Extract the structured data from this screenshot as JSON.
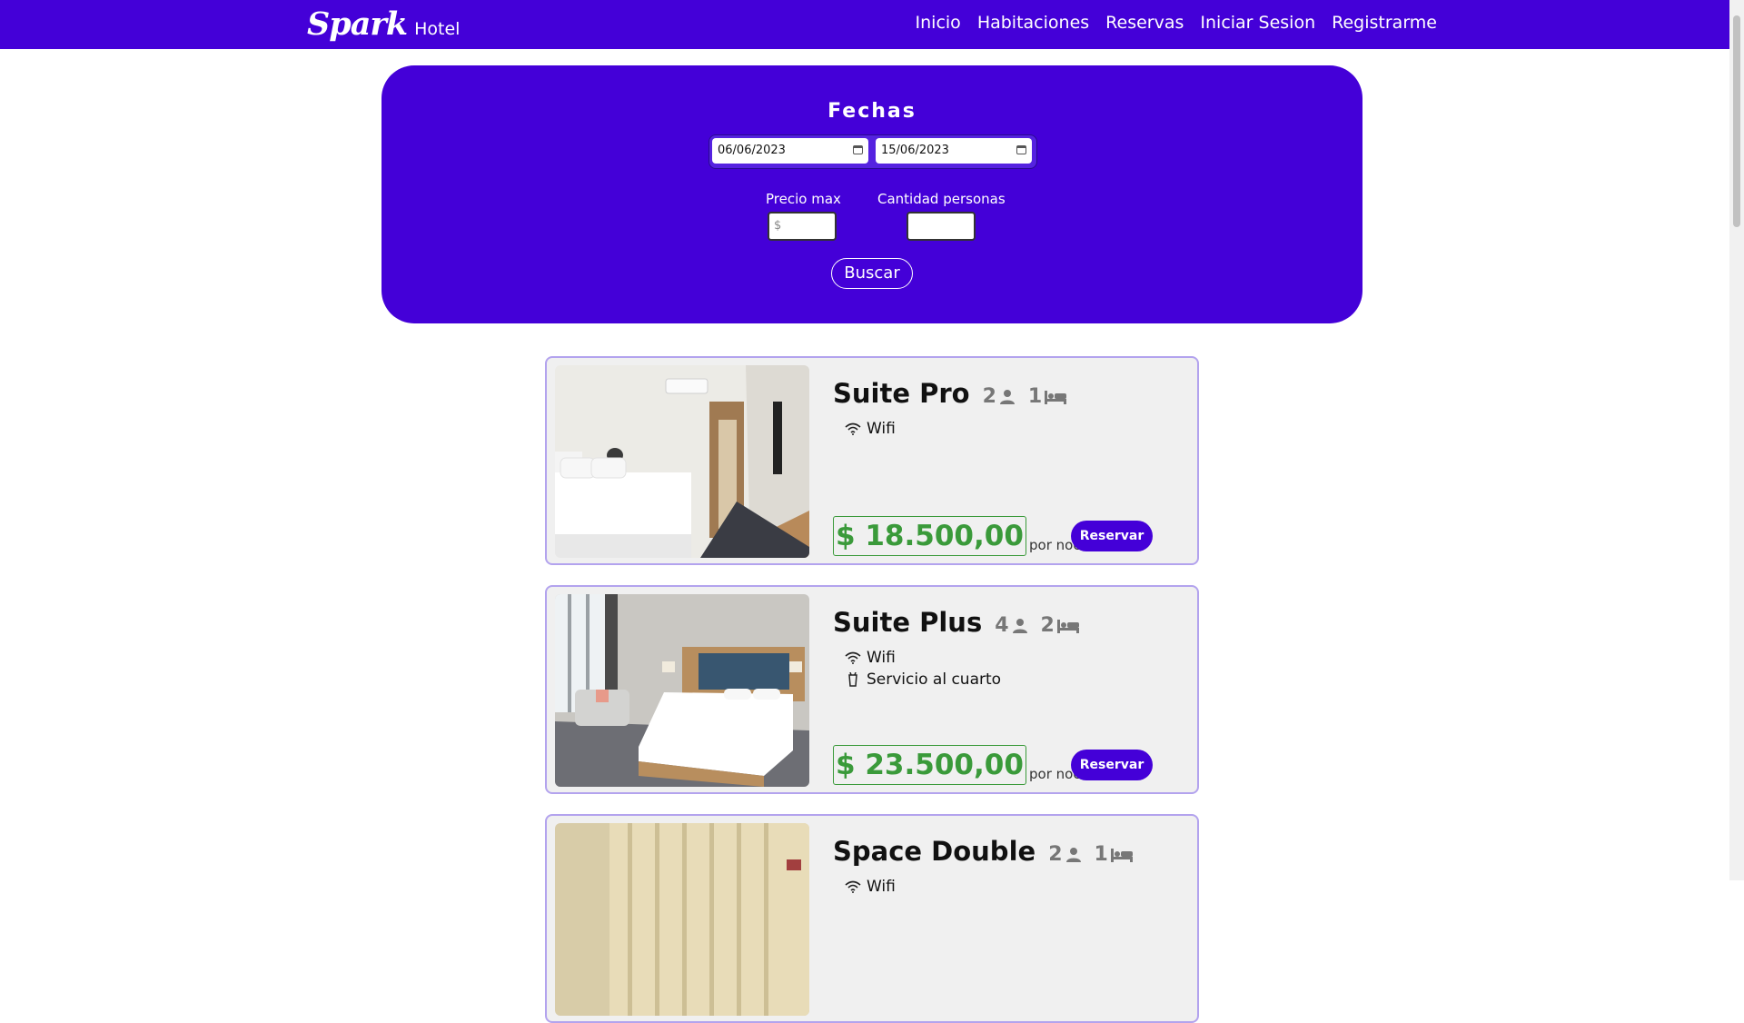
{
  "header": {
    "brand_script": "Spark",
    "brand_sub": "Hotel",
    "nav": [
      "Inicio",
      "Habitaciones",
      "Reservas",
      "Iniciar Sesion",
      "Registrarme"
    ]
  },
  "search": {
    "title": "Fechas",
    "start_date": "06/06/2023",
    "end_date": "15/06/2023",
    "price_label": "Precio max",
    "price_placeholder": "$",
    "people_label": "Cantidad personas",
    "people_value": "",
    "button": "Buscar"
  },
  "rooms": [
    {
      "name": "Suite Pro",
      "guests": "2",
      "beds": "1",
      "amenities": [
        "Wifi"
      ],
      "price": "$ 18.500,00",
      "per_night": "por noche",
      "button": "Reservar"
    },
    {
      "name": "Suite Plus",
      "guests": "4",
      "beds": "2",
      "amenities": [
        "Wifi",
        "Servicio al cuarto"
      ],
      "price": "$ 23.500,00",
      "per_night": "por noche",
      "button": "Reservar"
    },
    {
      "name": "Space Double",
      "guests": "2",
      "beds": "1",
      "amenities": [
        "Wifi"
      ]
    }
  ],
  "icons": {
    "guests": "person-icon",
    "beds": "bed-icon",
    "wifi": "wifi-icon",
    "room_service": "cup-icon",
    "calendar": "calendar-icon"
  },
  "colors": {
    "brand": "#4400d8",
    "price": "#3a9a3a",
    "card_border": "#b3a3ee",
    "card_bg": "#f0f0f0"
  }
}
